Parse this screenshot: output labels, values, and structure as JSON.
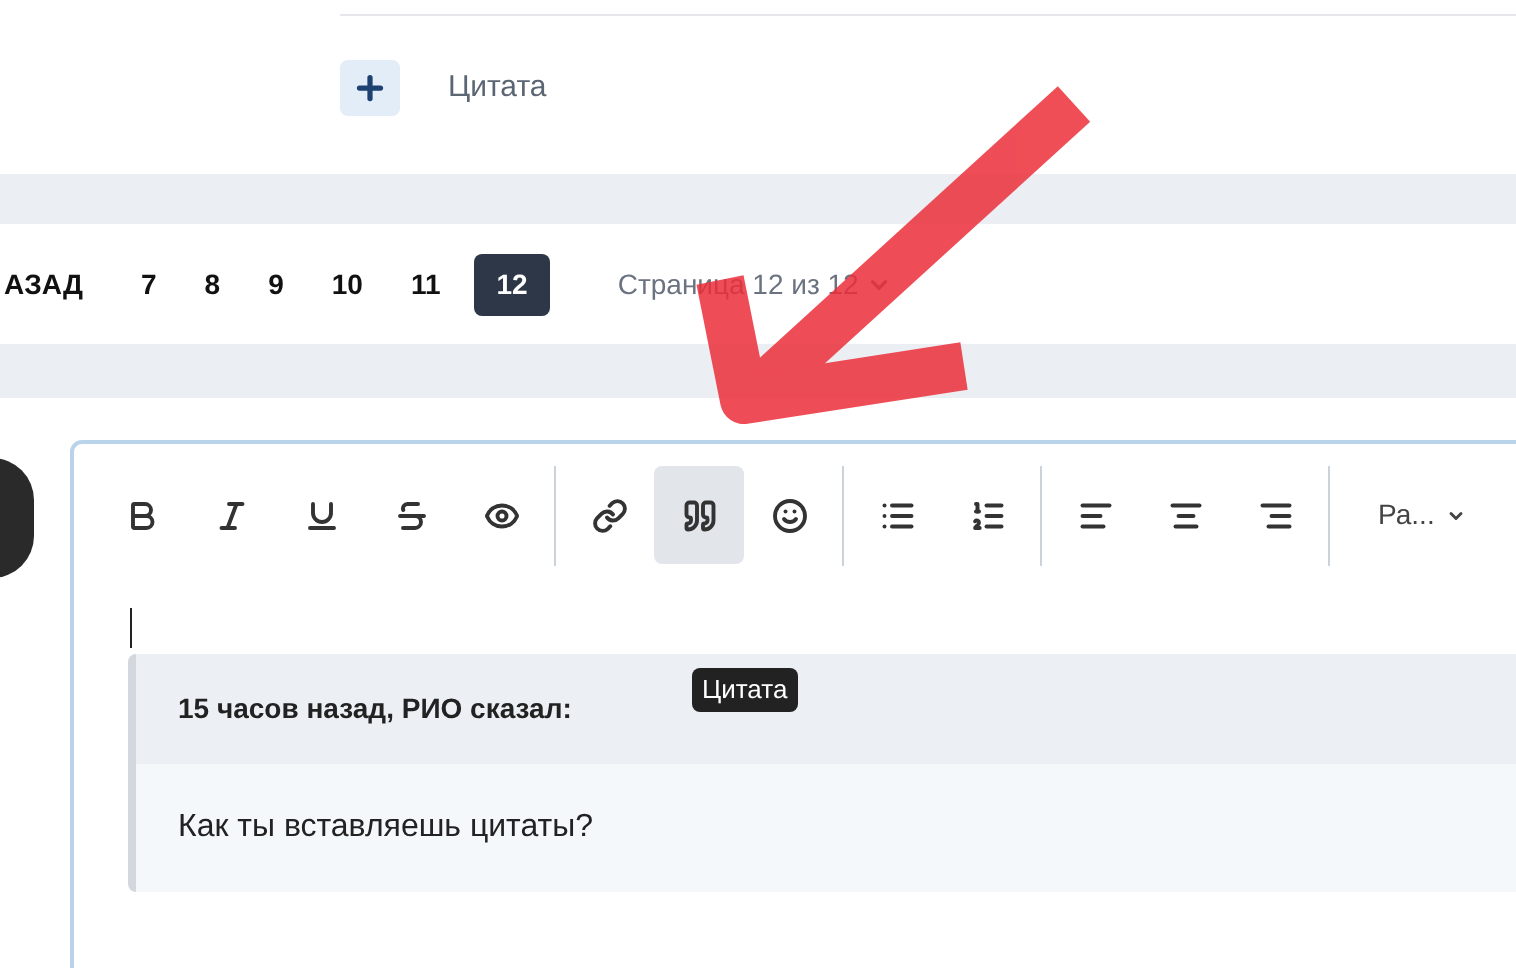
{
  "top_panel": {
    "add_button_label": "Цитата"
  },
  "pagination": {
    "back": "АЗАД",
    "pages": [
      {
        "label": "7",
        "selected": false
      },
      {
        "label": "8",
        "selected": false
      },
      {
        "label": "9",
        "selected": false
      },
      {
        "label": "10",
        "selected": false
      },
      {
        "label": "11",
        "selected": false
      },
      {
        "label": "12",
        "selected": true
      }
    ],
    "page_select": "Страница 12 из 12"
  },
  "editor": {
    "toolbar": [
      [
        {
          "kind": "bold",
          "highlighted": false
        },
        {
          "kind": "italic",
          "highlighted": false
        },
        {
          "kind": "underline",
          "highlighted": false
        },
        {
          "kind": "strikethrough",
          "highlighted": false
        },
        {
          "kind": "preview",
          "highlighted": false
        }
      ],
      [
        {
          "kind": "link",
          "highlighted": false
        },
        {
          "kind": "quote",
          "highlighted": true
        },
        {
          "kind": "emoji",
          "highlighted": false
        }
      ],
      [
        {
          "kind": "bullets",
          "highlighted": false
        },
        {
          "kind": "numbers",
          "highlighted": false
        }
      ],
      [
        {
          "kind": "left",
          "highlighted": false
        },
        {
          "kind": "center",
          "highlighted": false
        },
        {
          "kind": "right",
          "highlighted": false
        }
      ]
    ],
    "size_dropdown": "Ра...",
    "tooltip": "Цитата",
    "quote": {
      "header": "15 часов назад, РИО сказал:",
      "body": "Как ты вставляешь цитаты?"
    }
  }
}
